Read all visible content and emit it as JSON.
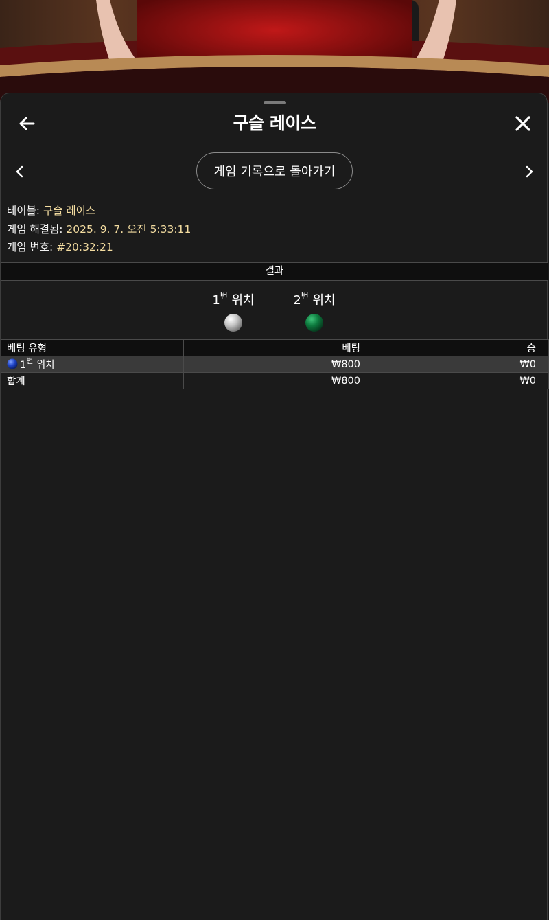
{
  "header": {
    "title": "구슬 레이스",
    "back_icon": "arrow-left-icon",
    "close_icon": "close-icon"
  },
  "nav": {
    "prev_icon": "chevron-left-icon",
    "next_icon": "chevron-right-icon",
    "back_to_history_label": "게임 기록으로 돌아가기"
  },
  "info": {
    "table_label": "테이블:",
    "table_value": "구슬 레이스",
    "resolved_label": "게임 해결됨:",
    "resolved_value": "2025. 9. 7. 오전 5:33:11",
    "game_no_label": "게임 번호:",
    "game_no_value": "#20:32:21",
    "value_color": "#f3dca0"
  },
  "result": {
    "header": "결과",
    "positions": [
      {
        "num": "1",
        "sup": "번",
        "label": "위치",
        "ball_color": "silver"
      },
      {
        "num": "2",
        "sup": "번",
        "label": "위치",
        "ball_color": "green"
      }
    ]
  },
  "table": {
    "columns": [
      "베팅 유형",
      "베팅",
      "승"
    ],
    "rows": [
      {
        "type_num": "1",
        "type_sup": "번",
        "type_label": "위치",
        "chip_color": "blue",
        "bet": "₩800",
        "win": "₩0"
      }
    ],
    "total": {
      "label": "합계",
      "bet": "₩800",
      "win": "₩0"
    }
  },
  "colors": {
    "sheet_bg": "#1b1b1b",
    "header_bg": "#0f0f0f",
    "highlight_row": "#3a3a3a",
    "accent_value": "#f3dca0"
  }
}
